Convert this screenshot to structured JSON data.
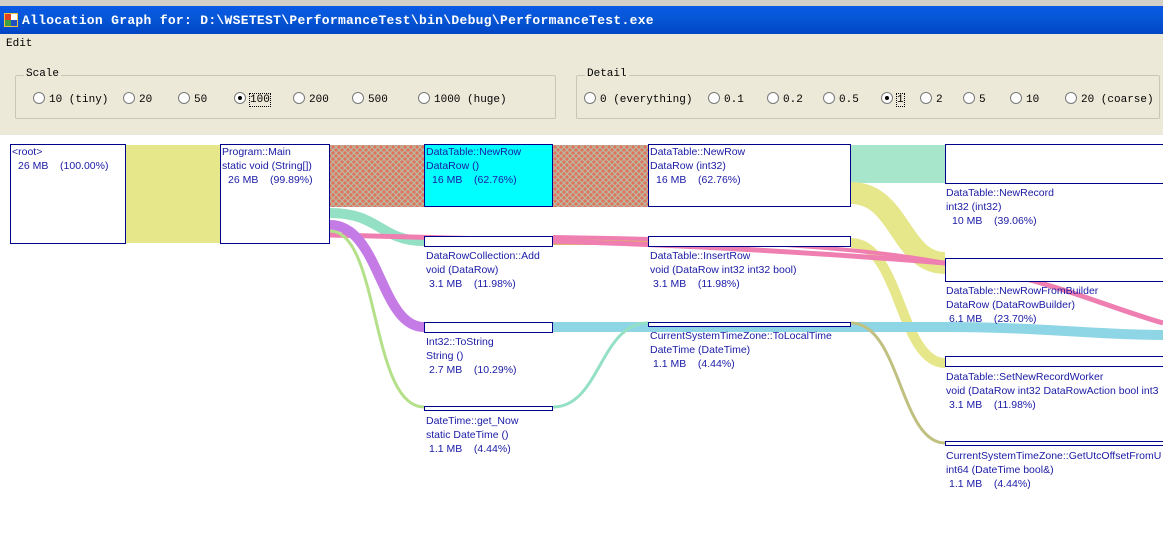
{
  "window": {
    "title": "Allocation Graph for: D:\\WSETEST\\PerformanceTest\\bin\\Debug\\PerformanceTest.exe"
  },
  "menu": {
    "edit": "Edit"
  },
  "scale": {
    "legend": "Scale",
    "options": [
      "10 (tiny)",
      "20",
      "50",
      "100",
      "200",
      "500",
      "1000 (huge)"
    ],
    "selected": "100"
  },
  "detail": {
    "legend": "Detail",
    "options": [
      "0 (everything)",
      "0.1",
      "0.2",
      "0.5",
      "1",
      "2",
      "5",
      "10",
      "20 (coarse)"
    ],
    "selected": "1"
  },
  "graph": {
    "nodes": {
      "root": {
        "name": "<root>",
        "sig": "",
        "stat": "26 MB    (100.00%)"
      },
      "main": {
        "name": "Program::Main",
        "sig": "static void (String[])",
        "stat": "26 MB    (99.89%)"
      },
      "newrow": {
        "name": "DataTable::NewRow",
        "sig": "DataRow ()",
        "stat": "16 MB    (62.76%)"
      },
      "newrow2": {
        "name": "DataTable::NewRow",
        "sig": "DataRow (int32)",
        "stat": "16 MB    (62.76%)"
      },
      "newrecord": {
        "name": "DataTable::NewRecord",
        "sig": "int32 (int32)",
        "stat": "10 MB    (39.06%)"
      },
      "add": {
        "name": "DataRowCollection::Add",
        "sig": "void (DataRow)",
        "stat": "3.1 MB    (11.98%)"
      },
      "insertrow": {
        "name": "DataTable::InsertRow",
        "sig": "void (DataRow int32 int32 bool)",
        "stat": "3.1 MB    (11.98%)"
      },
      "newrowfrombuilder": {
        "name": "DataTable::NewRowFromBuilder",
        "sig": "DataRow (DataRowBuilder)",
        "stat": "6.1 MB    (23.70%)"
      },
      "tostring": {
        "name": "Int32::ToString",
        "sig": "String ()",
        "stat": "2.7 MB    (10.29%)"
      },
      "tolocaltime": {
        "name": "CurrentSystemTimeZone::ToLocalTime",
        "sig": "DateTime (DateTime)",
        "stat": "1.1 MB    (4.44%)"
      },
      "setnewrecordworker": {
        "name": "DataTable::SetNewRecordWorker",
        "sig": "void (DataRow int32 DataRowAction bool int3",
        "stat": "3.1 MB    (11.98%)"
      },
      "getnow": {
        "name": "DateTime::get_Now",
        "sig": "static DateTime ()",
        "stat": "1.1 MB    (4.44%)"
      },
      "getutcoffset": {
        "name": "CurrentSystemTimeZone::GetUtcOffsetFromU",
        "sig": "int64 (DateTime bool&)",
        "stat": "1.1 MB    (4.44%)"
      }
    }
  },
  "colors": {
    "titlebar": "#0553d8",
    "chrome": "#ece9d8",
    "node_border": "#00008b",
    "node_text": "#1a1aa6",
    "highlight": "#00ffff",
    "flow_yellow": "#e6e68a",
    "flow_red_hatch": "#e0735e",
    "flow_teal": "#94e0c4",
    "flow_pink": "#ee7fb0",
    "flow_purple": "#c47be6",
    "flow_green": "#b5e08a",
    "flow_cyan": "#8ed6e6"
  }
}
